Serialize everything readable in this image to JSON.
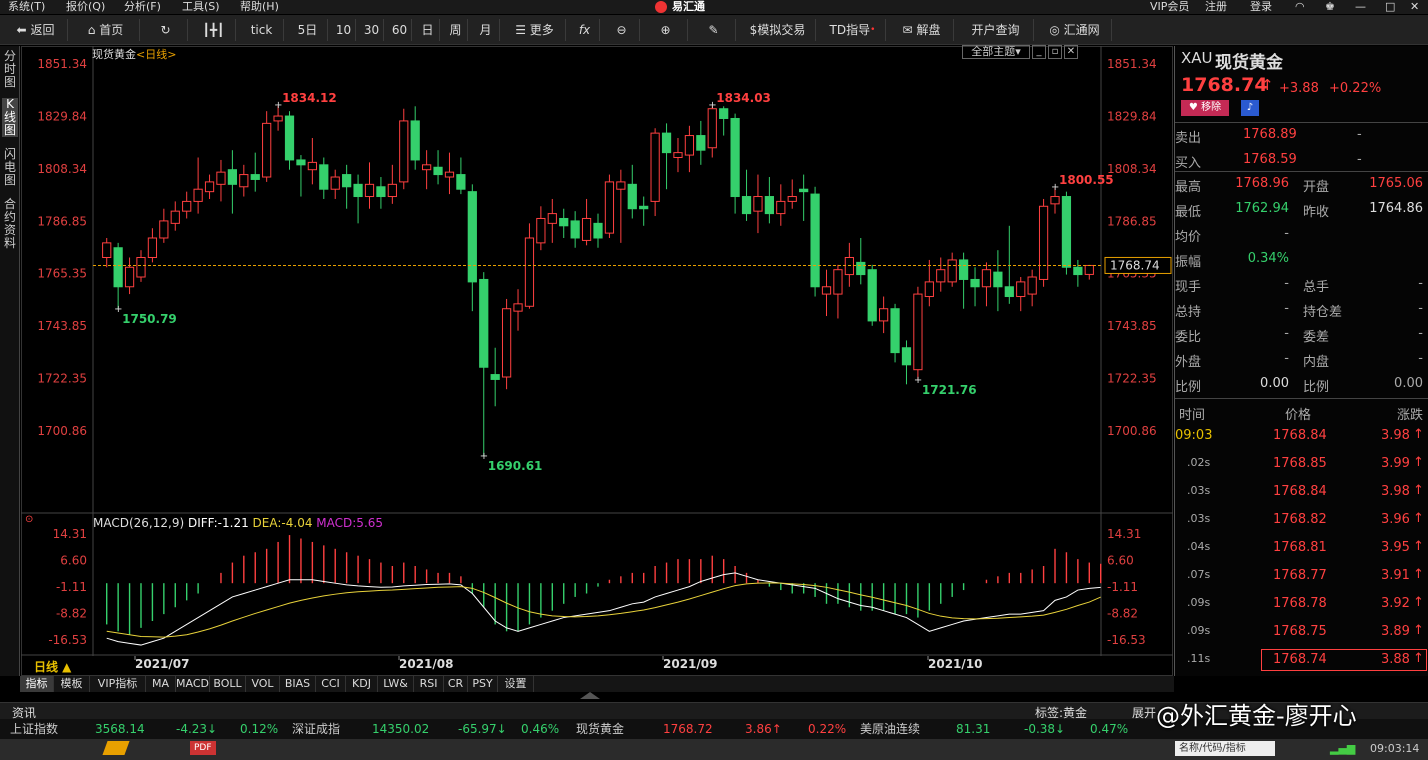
{
  "menu": [
    {
      "label": "系统(T)"
    },
    {
      "label": "报价(Q)"
    },
    {
      "label": "分析(F)"
    },
    {
      "label": "工具(S)"
    },
    {
      "label": "帮助(H)"
    }
  ],
  "app_title": "易汇通",
  "top_right": {
    "vip": "VIP会员",
    "register": "注册",
    "login": "登录"
  },
  "toolbar": {
    "back": "返回",
    "home": "首页",
    "tick": "tick",
    "p5d": "5日",
    "p10": "10",
    "p30": "30",
    "p60": "60",
    "day": "日",
    "week": "周",
    "month": "月",
    "more": "更多",
    "sim": "模拟交易",
    "td": "TD指导",
    "unlock": "解盘",
    "account": "开户查询",
    "hui": "汇通网"
  },
  "left_rail": [
    {
      "label": "分时图"
    },
    {
      "label": "K线图"
    },
    {
      "label": "闪电图"
    },
    {
      "label": "合约资料"
    }
  ],
  "chart_header": {
    "name": "现货黄金",
    "period": "<日线>",
    "theme_btn": "全部主题"
  },
  "price_axis": [
    "1851.34",
    "1829.84",
    "1808.34",
    "1786.85",
    "1765.35",
    "1743.85",
    "1722.35",
    "1700.86"
  ],
  "annotations": [
    {
      "text": "1834.12"
    },
    {
      "text": "1834.03"
    },
    {
      "text": "1800.55"
    },
    {
      "text": "1750.79"
    },
    {
      "text": "1690.61"
    },
    {
      "text": "1721.76"
    }
  ],
  "current_price_label": "1768.74",
  "macd": {
    "title": "MACD(26,12,9)",
    "diff": "DIFF:-1.21",
    "dea": "DEA:-4.04",
    "macd": "MACD:5.65",
    "axis": [
      "14.31",
      "6.60",
      "-1.11",
      "-8.82",
      "-16.53"
    ]
  },
  "date_axis": [
    "2021/07",
    "2021/08",
    "2021/09",
    "2021/10"
  ],
  "period_label": "日线 ▲",
  "indicator_tabs": [
    "指标",
    "模板",
    "VIP指标",
    "MA",
    "MACD",
    "BOLL",
    "VOL",
    "BIAS",
    "CCI",
    "KDJ",
    "LW&",
    "RSI",
    "CR",
    "PSY",
    "设置"
  ],
  "quote": {
    "symbol": "XAU",
    "name": "现货黄金",
    "price": "1768.74",
    "change": "+3.88",
    "pct": "+0.22%",
    "watch_btn": "移除",
    "sell_label": "卖出",
    "sell": "1768.89",
    "sell_vol": "-",
    "buy_label": "买入",
    "buy": "1768.59",
    "buy_vol": "-",
    "stats": [
      {
        "l1": "最高",
        "v1": "1768.96",
        "l2": "开盘",
        "v2": "1765.06"
      },
      {
        "l1": "最低",
        "v1": "1762.94",
        "l2": "昨收",
        "v2": "1764.86"
      },
      {
        "l1": "均价",
        "v1": "-",
        "l2": "",
        "v2": ""
      },
      {
        "l1": "振幅",
        "v1": "0.34%",
        "l2": "",
        "v2": ""
      },
      {
        "l1": "现手",
        "v1": "-",
        "l2": "总手",
        "v2": "-"
      },
      {
        "l1": "总持",
        "v1": "-",
        "l2": "持仓差",
        "v2": "-"
      },
      {
        "l1": "委比",
        "v1": "-",
        "l2": "委差",
        "v2": "-"
      },
      {
        "l1": "外盘",
        "v1": "-",
        "l2": "内盘",
        "v2": "-"
      },
      {
        "l1": "比例",
        "v1": "0.00",
        "l2": "比例",
        "v2": "0.00"
      }
    ],
    "ticks_header": [
      "时间",
      "价格",
      "涨跌"
    ],
    "ticks": [
      {
        "t": "09:03",
        "p": "1768.84",
        "c": "3.98"
      },
      {
        "t": ".02s",
        "p": "1768.85",
        "c": "3.99"
      },
      {
        "t": ".03s",
        "p": "1768.84",
        "c": "3.98"
      },
      {
        "t": ".03s",
        "p": "1768.82",
        "c": "3.96"
      },
      {
        "t": ".04s",
        "p": "1768.81",
        "c": "3.95"
      },
      {
        "t": ".07s",
        "p": "1768.77",
        "c": "3.91"
      },
      {
        "t": ".09s",
        "p": "1768.78",
        "c": "3.92"
      },
      {
        "t": ".09s",
        "p": "1768.75",
        "c": "3.89"
      },
      {
        "t": ".11s",
        "p": "1768.74",
        "c": "3.88"
      }
    ]
  },
  "infobar": {
    "news": "资讯",
    "tag": "标签:黄金",
    "expand": "展开"
  },
  "ticker": [
    {
      "name": "上证指数",
      "val": "3568.14",
      "chg": "-4.23↓",
      "pct": "0.12%"
    },
    {
      "name": "深证成指",
      "val": "14350.02",
      "chg": "-65.97↓",
      "pct": "0.46%"
    },
    {
      "name": "现货黄金",
      "val": "1768.72",
      "chg": "3.86↑",
      "pct": "0.22%"
    },
    {
      "name": "美原油连续",
      "val": "81.31",
      "chg": "-0.38↓",
      "pct": "0.47%"
    }
  ],
  "taskbar": {
    "pdf": "PDF",
    "time": "09:03:14",
    "search": "名称/代码/指标"
  },
  "watermark": "@外汇黄金-廖开心",
  "chart_data": {
    "type": "candlestick",
    "ylim": [
      1690.61,
      1851.34
    ],
    "candles": [
      {
        "o": 1772,
        "c": 1778,
        "h": 1780,
        "l": 1768
      },
      {
        "o": 1776,
        "c": 1760,
        "h": 1778,
        "l": 1750.79
      },
      {
        "o": 1760,
        "c": 1768,
        "h": 1772,
        "l": 1757
      },
      {
        "o": 1764,
        "c": 1772,
        "h": 1775,
        "l": 1762
      },
      {
        "o": 1772,
        "c": 1780,
        "h": 1784,
        "l": 1770
      },
      {
        "o": 1780,
        "c": 1787,
        "h": 1792,
        "l": 1778
      },
      {
        "o": 1786,
        "c": 1791,
        "h": 1795,
        "l": 1783
      },
      {
        "o": 1791,
        "c": 1795,
        "h": 1799,
        "l": 1788
      },
      {
        "o": 1795,
        "c": 1800,
        "h": 1813,
        "l": 1790
      },
      {
        "o": 1799,
        "c": 1803,
        "h": 1806,
        "l": 1796
      },
      {
        "o": 1802,
        "c": 1807,
        "h": 1812,
        "l": 1795
      },
      {
        "o": 1808,
        "c": 1802,
        "h": 1816,
        "l": 1790
      },
      {
        "o": 1801,
        "c": 1806,
        "h": 1810,
        "l": 1797
      },
      {
        "o": 1806,
        "c": 1804,
        "h": 1815,
        "l": 1799
      },
      {
        "o": 1805,
        "c": 1827,
        "h": 1832,
        "l": 1803
      },
      {
        "o": 1828,
        "c": 1830,
        "h": 1834.12,
        "l": 1824
      },
      {
        "o": 1830,
        "c": 1812,
        "h": 1832,
        "l": 1808
      },
      {
        "o": 1812,
        "c": 1810,
        "h": 1814,
        "l": 1797
      },
      {
        "o": 1808,
        "c": 1811,
        "h": 1821,
        "l": 1802
      },
      {
        "o": 1810,
        "c": 1800,
        "h": 1813,
        "l": 1796
      },
      {
        "o": 1800,
        "c": 1805,
        "h": 1808,
        "l": 1796
      },
      {
        "o": 1806,
        "c": 1801,
        "h": 1810,
        "l": 1792
      },
      {
        "o": 1802,
        "c": 1797,
        "h": 1806,
        "l": 1786
      },
      {
        "o": 1797,
        "c": 1802,
        "h": 1811,
        "l": 1792
      },
      {
        "o": 1801,
        "c": 1797,
        "h": 1805,
        "l": 1792
      },
      {
        "o": 1797,
        "c": 1802,
        "h": 1810,
        "l": 1794
      },
      {
        "o": 1803,
        "c": 1828,
        "h": 1833,
        "l": 1800
      },
      {
        "o": 1828,
        "c": 1812,
        "h": 1834,
        "l": 1808
      },
      {
        "o": 1808,
        "c": 1810,
        "h": 1816,
        "l": 1800
      },
      {
        "o": 1809,
        "c": 1806,
        "h": 1816,
        "l": 1802
      },
      {
        "o": 1805,
        "c": 1807,
        "h": 1815,
        "l": 1798
      },
      {
        "o": 1806,
        "c": 1800,
        "h": 1813,
        "l": 1798
      },
      {
        "o": 1799,
        "c": 1762,
        "h": 1802,
        "l": 1750
      },
      {
        "o": 1763,
        "c": 1727,
        "h": 1766,
        "l": 1690.61
      },
      {
        "o": 1724,
        "c": 1722,
        "h": 1735,
        "l": 1711
      },
      {
        "o": 1723,
        "c": 1751,
        "h": 1755,
        "l": 1718
      },
      {
        "o": 1750,
        "c": 1753,
        "h": 1759,
        "l": 1742
      },
      {
        "o": 1752,
        "c": 1780,
        "h": 1786,
        "l": 1751
      },
      {
        "o": 1778,
        "c": 1788,
        "h": 1793,
        "l": 1775
      },
      {
        "o": 1786,
        "c": 1790,
        "h": 1796,
        "l": 1778
      },
      {
        "o": 1788,
        "c": 1785,
        "h": 1792,
        "l": 1780
      },
      {
        "o": 1787,
        "c": 1780,
        "h": 1791,
        "l": 1776
      },
      {
        "o": 1779,
        "c": 1788,
        "h": 1796,
        "l": 1777
      },
      {
        "o": 1786,
        "c": 1780,
        "h": 1790,
        "l": 1776
      },
      {
        "o": 1782,
        "c": 1803,
        "h": 1806,
        "l": 1780
      },
      {
        "o": 1800,
        "c": 1803,
        "h": 1808,
        "l": 1778
      },
      {
        "o": 1802,
        "c": 1792,
        "h": 1810,
        "l": 1788
      },
      {
        "o": 1793,
        "c": 1792,
        "h": 1797,
        "l": 1785
      },
      {
        "o": 1795,
        "c": 1823,
        "h": 1825,
        "l": 1789
      },
      {
        "o": 1823,
        "c": 1815,
        "h": 1827,
        "l": 1800
      },
      {
        "o": 1813,
        "c": 1815,
        "h": 1821,
        "l": 1807
      },
      {
        "o": 1814,
        "c": 1822,
        "h": 1826,
        "l": 1807
      },
      {
        "o": 1822,
        "c": 1816,
        "h": 1828,
        "l": 1810
      },
      {
        "o": 1817,
        "c": 1833,
        "h": 1834.03,
        "l": 1813
      },
      {
        "o": 1833,
        "c": 1829,
        "h": 1834,
        "l": 1822
      },
      {
        "o": 1829,
        "c": 1797,
        "h": 1831,
        "l": 1790
      },
      {
        "o": 1797,
        "c": 1790,
        "h": 1808,
        "l": 1787
      },
      {
        "o": 1791,
        "c": 1797,
        "h": 1806,
        "l": 1782
      },
      {
        "o": 1797,
        "c": 1790,
        "h": 1805,
        "l": 1786
      },
      {
        "o": 1790,
        "c": 1795,
        "h": 1802,
        "l": 1785
      },
      {
        "o": 1795,
        "c": 1797,
        "h": 1804,
        "l": 1792
      },
      {
        "o": 1800,
        "c": 1799,
        "h": 1806,
        "l": 1787
      },
      {
        "o": 1798,
        "c": 1760,
        "h": 1801,
        "l": 1756
      },
      {
        "o": 1757,
        "c": 1760,
        "h": 1767,
        "l": 1748
      },
      {
        "o": 1757,
        "c": 1767,
        "h": 1769,
        "l": 1747
      },
      {
        "o": 1765,
        "c": 1772,
        "h": 1778,
        "l": 1760
      },
      {
        "o": 1770,
        "c": 1765,
        "h": 1780,
        "l": 1761
      },
      {
        "o": 1767,
        "c": 1746,
        "h": 1769,
        "l": 1744
      },
      {
        "o": 1746,
        "c": 1751,
        "h": 1756,
        "l": 1741
      },
      {
        "o": 1751,
        "c": 1733,
        "h": 1753,
        "l": 1729
      },
      {
        "o": 1735,
        "c": 1728,
        "h": 1738,
        "l": 1720
      },
      {
        "o": 1726,
        "c": 1757,
        "h": 1760,
        "l": 1721.76
      },
      {
        "o": 1756,
        "c": 1762,
        "h": 1771,
        "l": 1752
      },
      {
        "o": 1762,
        "c": 1767,
        "h": 1772,
        "l": 1758
      },
      {
        "o": 1762,
        "c": 1771,
        "h": 1774,
        "l": 1760
      },
      {
        "o": 1771,
        "c": 1763,
        "h": 1774,
        "l": 1751
      },
      {
        "o": 1763,
        "c": 1760,
        "h": 1768,
        "l": 1752
      },
      {
        "o": 1760,
        "c": 1767,
        "h": 1770,
        "l": 1752
      },
      {
        "o": 1766,
        "c": 1760,
        "h": 1775,
        "l": 1750
      },
      {
        "o": 1760,
        "c": 1756,
        "h": 1785,
        "l": 1753
      },
      {
        "o": 1756,
        "c": 1762,
        "h": 1764,
        "l": 1750
      },
      {
        "o": 1757,
        "c": 1764,
        "h": 1767,
        "l": 1752
      },
      {
        "o": 1763,
        "c": 1793,
        "h": 1796,
        "l": 1760
      },
      {
        "o": 1794,
        "c": 1797,
        "h": 1800.55,
        "l": 1790
      },
      {
        "o": 1797,
        "c": 1768,
        "h": 1799,
        "l": 1765
      },
      {
        "o": 1768,
        "c": 1765,
        "h": 1771,
        "l": 1760
      },
      {
        "o": 1765.06,
        "c": 1768.74,
        "h": 1768.96,
        "l": 1762.94
      }
    ],
    "macd_hist": [
      -12,
      -14,
      -15,
      -13,
      -11,
      -9,
      -7,
      -5,
      -3,
      0,
      3,
      6,
      8,
      9,
      10,
      12,
      14,
      13,
      12,
      11,
      10,
      9,
      8,
      7,
      6,
      5,
      6,
      5,
      4,
      3,
      3,
      2,
      -3,
      -7,
      -12,
      -14,
      -14,
      -12,
      -10,
      -8,
      -6,
      -4,
      -3,
      -1,
      1,
      2,
      3,
      3,
      5,
      6,
      7,
      7,
      7,
      8,
      7,
      5,
      3,
      1,
      -1,
      -2,
      -3,
      -3,
      -4,
      -6,
      -6,
      -7,
      -8,
      -8,
      -8,
      -9,
      -9,
      -10,
      -8,
      -6,
      -4,
      -2,
      0,
      1,
      2,
      3,
      3,
      4,
      5,
      10,
      9,
      7,
      6,
      5.65
    ],
    "diff": [
      -16,
      -17,
      -17.5,
      -18,
      -17,
      -16,
      -14,
      -12,
      -10,
      -8,
      -6,
      -4,
      -3,
      -2,
      -1,
      0,
      1,
      1,
      1,
      0.5,
      0,
      -0.5,
      -0.8,
      -1,
      -1.2,
      -1.1,
      -0.8,
      -0.6,
      -0.4,
      -0.3,
      -0.2,
      -0.5,
      -3,
      -7,
      -11,
      -13,
      -14,
      -13,
      -12,
      -11,
      -10,
      -9.5,
      -9,
      -8.5,
      -8,
      -7,
      -6,
      -5.5,
      -4,
      -3,
      -2,
      -1,
      0.5,
      1.5,
      2.5,
      3,
      2,
      1,
      0.5,
      0,
      -0.5,
      -1,
      -1.5,
      -3,
      -4.5,
      -5.5,
      -6.5,
      -7,
      -8,
      -9,
      -10,
      -12,
      -14,
      -13,
      -12,
      -11,
      -10.5,
      -10,
      -9.5,
      -9,
      -9,
      -8.5,
      -8,
      -5,
      -4,
      -2,
      -1.5,
      -1.21
    ],
    "dea": [
      -14,
      -14.5,
      -15,
      -15.5,
      -15.6,
      -15.7,
      -15.4,
      -15,
      -14.2,
      -13.3,
      -12.2,
      -11,
      -9.9,
      -8.8,
      -7.8,
      -6.8,
      -5.8,
      -5,
      -4.3,
      -3.7,
      -3.2,
      -2.8,
      -2.5,
      -2.3,
      -2.1,
      -2,
      -1.8,
      -1.6,
      -1.4,
      -1.2,
      -1.1,
      -1,
      -1.5,
      -2.7,
      -4.2,
      -5.8,
      -7.2,
      -8.3,
      -9,
      -9.5,
      -9.7,
      -9.8,
      -9.7,
      -9.5,
      -9.2,
      -8.8,
      -8.3,
      -7.8,
      -7.1,
      -6.3,
      -5.5,
      -4.6,
      -3.6,
      -2.6,
      -1.6,
      -0.7,
      -0.2,
      0,
      0.1,
      0,
      -0.2,
      -0.4,
      -0.7,
      -1.2,
      -1.9,
      -2.6,
      -3.4,
      -4.1,
      -4.9,
      -5.7,
      -6.5,
      -7.6,
      -8.8,
      -9.6,
      -10.1,
      -10.3,
      -10.4,
      -10.3,
      -10.2,
      -10,
      -9.8,
      -9.6,
      -9.3,
      -8.5,
      -7.6,
      -6.5,
      -5.5,
      -4.04
    ]
  }
}
